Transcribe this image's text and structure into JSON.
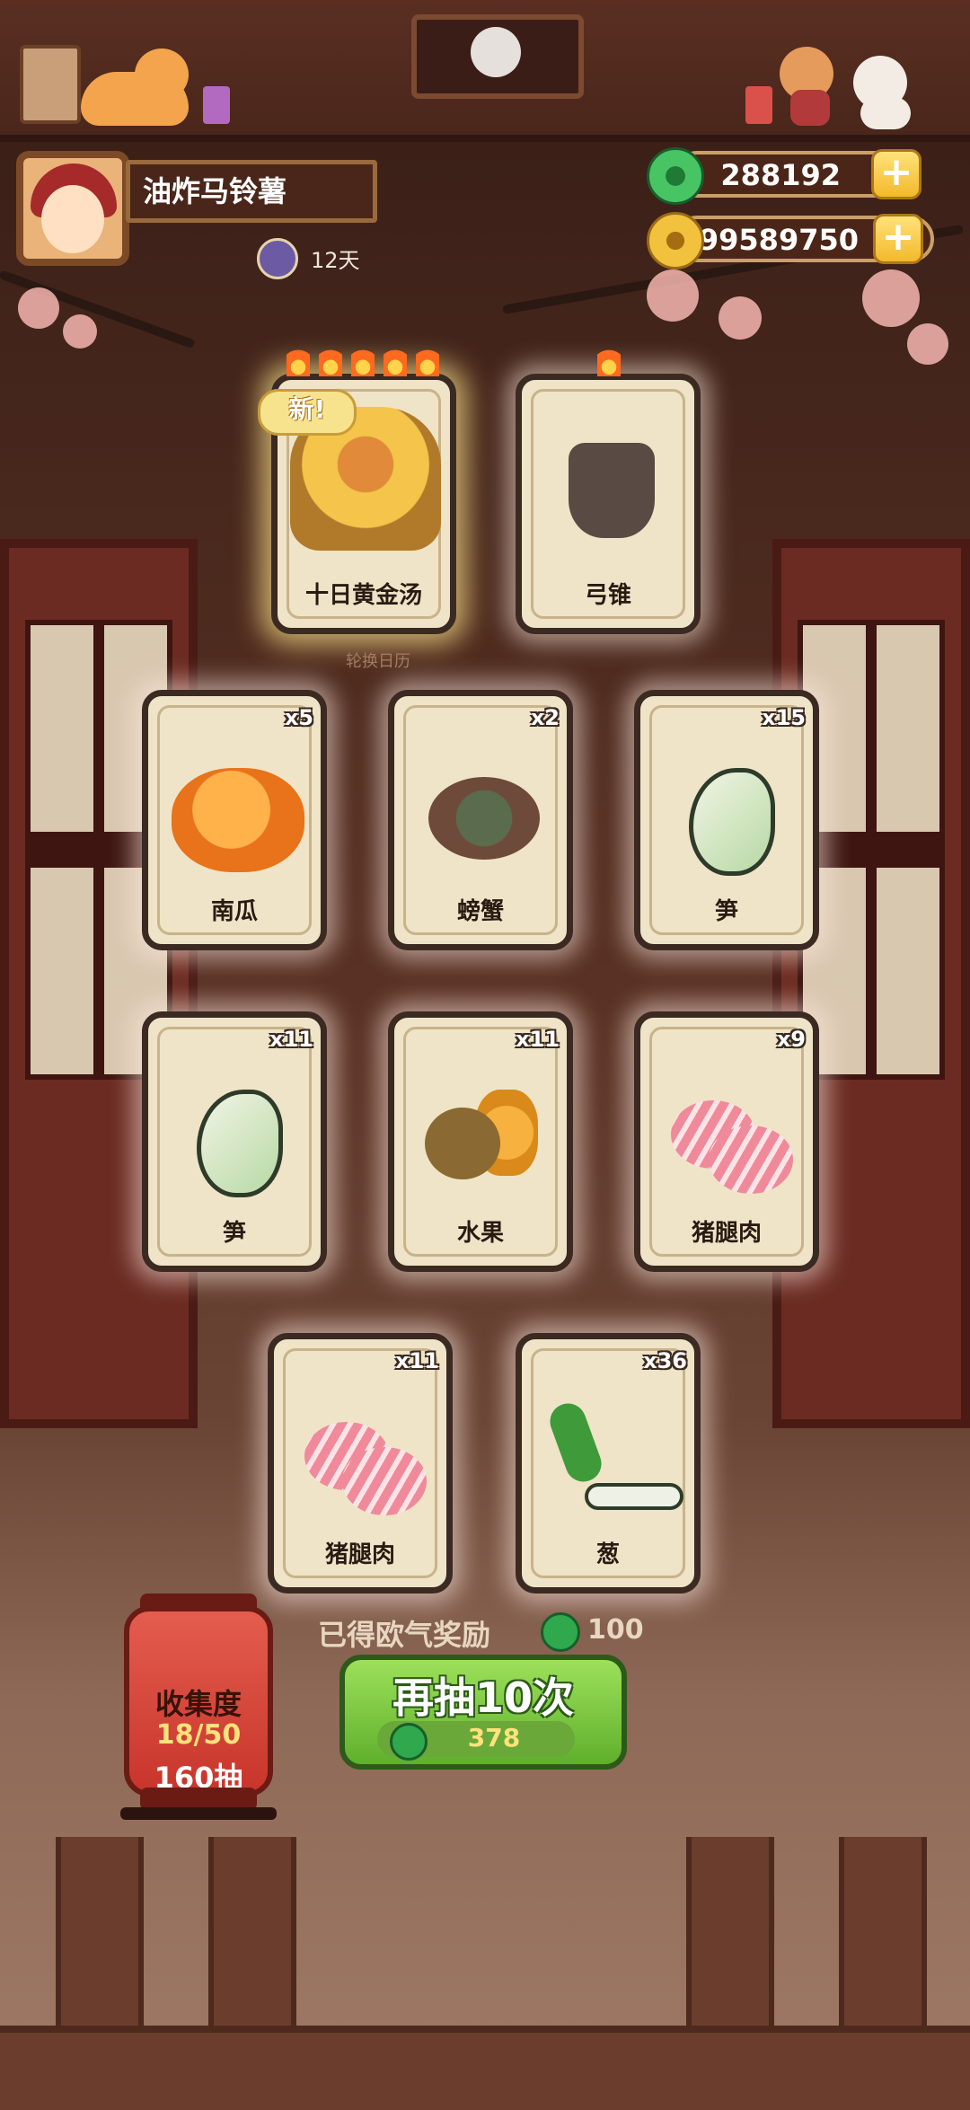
{
  "player": {
    "name": "油炸马铃薯",
    "days": "12天"
  },
  "currency": {
    "jade": "288192",
    "coins": "99589750",
    "plus": "+"
  },
  "top_cards": [
    {
      "label": "十日黄金汤",
      "flames": 5,
      "badge": "新!"
    },
    {
      "label": "弓锥",
      "flames": 1
    }
  ],
  "rotation_label": "轮换日历",
  "cards": [
    {
      "label": "南瓜",
      "count": "x5"
    },
    {
      "label": "螃蟹",
      "count": "x2"
    },
    {
      "label": "笋",
      "count": "x15"
    },
    {
      "label": "笋",
      "count": "x11"
    },
    {
      "label": "水果",
      "count": "x11"
    },
    {
      "label": "猪腿肉",
      "count": "x9"
    },
    {
      "label": "猪腿肉",
      "count": "x11"
    },
    {
      "label": "葱",
      "count": "x36"
    }
  ],
  "collection": {
    "title": "收集度",
    "progress": "18/50",
    "draws": "160抽"
  },
  "luck_reward": {
    "label": "已得欧气奖励",
    "value": "100"
  },
  "draw_button": {
    "label": "再抽10次",
    "cost": "378"
  }
}
